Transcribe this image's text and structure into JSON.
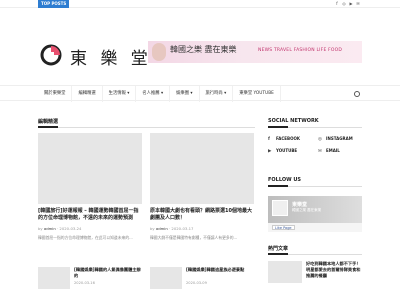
{
  "topbar": {
    "tag": "TOP POSTS",
    "social_icons": [
      "facebook-icon",
      "instagram-icon",
      "youtube-icon",
      "mail-icon"
    ]
  },
  "logo": {
    "text": "東 樂 堂"
  },
  "banner": {
    "title": "韓國之樂 盡在東樂",
    "sub": "NEWS TRAVEL FASHION LIFE FOOD"
  },
  "nav": {
    "items": [
      "關於東樂堂",
      "編輯精選",
      "生活情報 ▾",
      "名人推薦 ▾",
      "娛樂圈 ▾",
      "旅行時尚 ▾",
      "東樂堂 YOUTUBE"
    ]
  },
  "main": {
    "section_title": "編輯精選",
    "cards": [
      {
        "title": "[韓國旅行]好運報報 – 韓國運勢韓國首屈一指的方位命理博物館，不遠的未來的運勢預測",
        "author": "admin",
        "date": "2020-03-24",
        "excerpt": "韓國首屈一指的方位命理博物館，在此可以知道未來的..."
      },
      {
        "title": "原本韓國大劇也有看頭？網路票選10個地最大劇團及人口數！",
        "author": "admin",
        "date": "2020-03-17",
        "excerpt": "韓國大劇不僅是韓國特有劇種，不僅讓人有更多的..."
      }
    ],
    "small": [
      {
        "title": "[韓國娛樂]韓國的人氣偶像團體主辦的",
        "date": "2020-03-16"
      },
      {
        "title": "[韓國娛樂]韓國追星族必遊景點",
        "date": "2020-03-09"
      }
    ]
  },
  "sidebar": {
    "social_title": "SOCIAL NETWORK",
    "social": [
      {
        "icon": "facebook-icon",
        "glyph": "f",
        "label": "FACEBOOK"
      },
      {
        "icon": "instagram-icon",
        "glyph": "◎",
        "label": "INSTAGRAM"
      },
      {
        "icon": "youtube-icon",
        "glyph": "▶",
        "label": "YOUTUBE"
      },
      {
        "icon": "mail-icon",
        "glyph": "✉",
        "label": "EMAIL"
      }
    ],
    "follow_title": "FOLLOW US",
    "fb": {
      "name": "東樂堂",
      "count": "韓國之樂 盡在東樂",
      "like": "Like Page"
    },
    "popular_title": "熱門文章",
    "popular": [
      {
        "title": "好吃到韓國本地人都不下手！明星都愛去的首爾排隊美食和推薦的餐廳"
      }
    ]
  }
}
